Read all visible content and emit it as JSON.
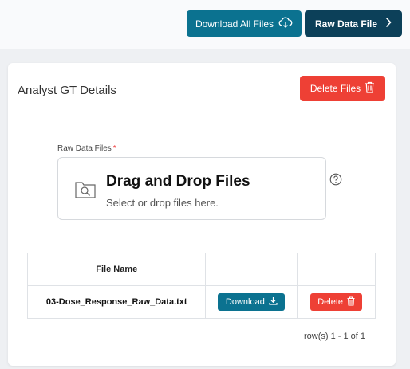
{
  "header": {
    "download_all_label": "Download All Files",
    "raw_data_label": "Raw Data File"
  },
  "card": {
    "title": "Analyst GT Details",
    "delete_files_label": "Delete Files"
  },
  "upload": {
    "label": "Raw Data Files",
    "required_mark": "*",
    "title": "Drag and Drop Files",
    "subtitle": "Select or drop files here."
  },
  "table": {
    "columns": [
      "File Name",
      "",
      ""
    ],
    "rows": [
      {
        "file_name": "03-Dose_Response_Raw_Data.txt",
        "download_label": "Download",
        "delete_label": "Delete"
      }
    ]
  },
  "pager": {
    "text": "row(s) 1 - 1 of 1"
  },
  "colors": {
    "primary": "#0b7290",
    "dark_primary": "#0c4059",
    "danger": "#ee4035"
  }
}
